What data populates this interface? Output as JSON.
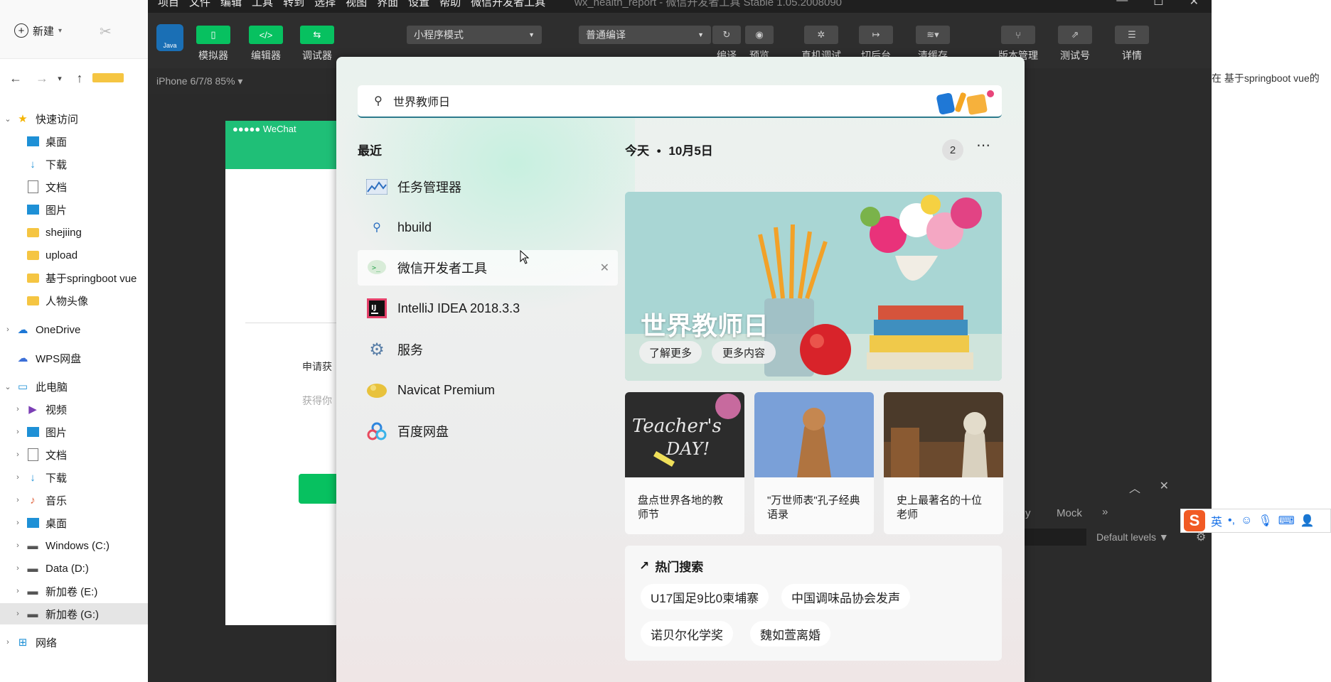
{
  "explorer": {
    "new_label": "新建",
    "tree": [
      {
        "label": "快速访问",
        "icon": "star-icon",
        "top": 0
      },
      {
        "label": "桌面",
        "icon": "desktop-icon"
      },
      {
        "label": "下载",
        "icon": "download-icon"
      },
      {
        "label": "文档",
        "icon": "document-icon"
      },
      {
        "label": "图片",
        "icon": "picture-icon"
      },
      {
        "label": "shejiing",
        "icon": "folder-icon"
      },
      {
        "label": "upload",
        "icon": "folder-icon"
      },
      {
        "label": "基于springboot vue",
        "icon": "folder-icon"
      },
      {
        "label": "人物头像",
        "icon": "folder-icon"
      },
      {
        "label": "OneDrive",
        "icon": "cloud-icon"
      },
      {
        "label": "WPS网盘",
        "icon": "cloud-icon"
      },
      {
        "label": "此电脑",
        "icon": "computer-icon"
      },
      {
        "label": "视频",
        "icon": "video-icon"
      },
      {
        "label": "图片",
        "icon": "picture-icon"
      },
      {
        "label": "文档",
        "icon": "document-icon"
      },
      {
        "label": "下载",
        "icon": "download-icon"
      },
      {
        "label": "音乐",
        "icon": "music-icon"
      },
      {
        "label": "桌面",
        "icon": "desktop-icon"
      },
      {
        "label": "Windows (C:)",
        "icon": "drive-icon"
      },
      {
        "label": "Data (D:)",
        "icon": "drive-icon"
      },
      {
        "label": "新加卷 (E:)",
        "icon": "drive-icon"
      },
      {
        "label": "新加卷 (G:)",
        "icon": "drive-icon"
      },
      {
        "label": "网络",
        "icon": "network-icon"
      }
    ]
  },
  "devtools": {
    "menu": [
      "项目",
      "文件",
      "编辑",
      "工具",
      "转到",
      "选择",
      "视图",
      "界面",
      "设置",
      "帮助",
      "微信开发者工具"
    ],
    "window_title": "wx_health_report - 微信开发者工具 Stable 1.05.2008090",
    "avatar_text": "Java",
    "simulator_label": "模拟器",
    "editor_label": "编辑器",
    "debugger_label": "调试器",
    "mode_select": "小程序模式",
    "compile_select": "普通编译",
    "compile_label": "编译",
    "preview_label": "预览",
    "realdevice_label": "真机调试",
    "background_label": "切后台",
    "clearcache_label": "清缓存",
    "version_label": "版本管理",
    "testid_label": "测试号",
    "details_label": "详情",
    "device_label": "iPhone 6/7/8 85% ▾",
    "phone_status": "●●●●● WeChat",
    "phone_text1": "申请获",
    "phone_text2": "获得你",
    "console_tab_partial": "y",
    "console_tab_mock": "Mock",
    "console_levels": "Default levels ▼"
  },
  "behind_right": {
    "text": "在 基于springboot vue的"
  },
  "ime": {
    "lang": "英"
  },
  "flyout": {
    "search_value": "世界教师日",
    "recent_header": "最近",
    "recent": [
      {
        "label": "任务管理器",
        "icon": "task-manager-icon"
      },
      {
        "label": "hbuild",
        "icon": "search-icon"
      },
      {
        "label": "微信开发者工具",
        "icon": "wechat-devtools-icon"
      },
      {
        "label": "IntelliJ IDEA 2018.3.3",
        "icon": "intellij-icon"
      },
      {
        "label": "服务",
        "icon": "services-icon"
      },
      {
        "label": "Navicat Premium",
        "icon": "navicat-icon"
      },
      {
        "label": "百度网盘",
        "icon": "baidu-netdisk-icon"
      }
    ],
    "today_label": "今天",
    "date_label": "10月5日",
    "badge_count": "2",
    "hero": {
      "title": "世界教师日",
      "learn_more": "了解更多",
      "more_content": "更多内容"
    },
    "cards": [
      {
        "caption": "盘点世界各地的教师节"
      },
      {
        "caption": "\"万世师表\"孔子经典语录"
      },
      {
        "caption": "史上最著名的十位老师"
      }
    ],
    "hot_header": "热门搜索",
    "hot": [
      "U17国足9比0柬埔寨",
      "中国调味品协会发声",
      "诺贝尔化学奖",
      "魏如萱离婚"
    ]
  },
  "colors": {
    "accent_green": "#07c160",
    "search_underline": "#2c7a8c"
  }
}
